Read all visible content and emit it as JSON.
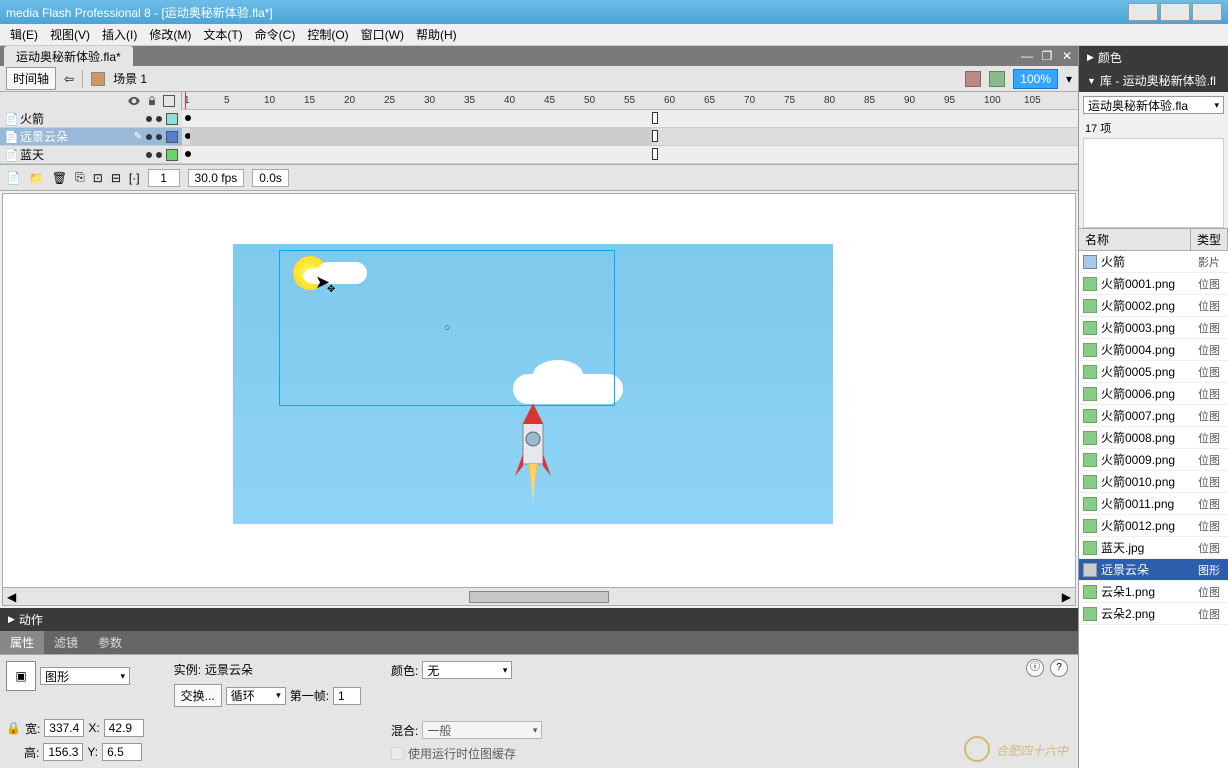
{
  "titlebar": {
    "title": "media Flash Professional 8 - [运动奥秘新体验.fla*]"
  },
  "menu": [
    "辑(E)",
    "视图(V)",
    "插入(I)",
    "修改(M)",
    "文本(T)",
    "命令(C)",
    "控制(O)",
    "窗口(W)",
    "帮助(H)"
  ],
  "doc": {
    "tab": "运动奥秘新体验.fla*",
    "timeline_btn": "时间轴",
    "scene": "场景 1",
    "zoom": "100%"
  },
  "ruler": [
    1,
    5,
    10,
    15,
    20,
    25,
    30,
    35,
    40,
    45,
    50,
    55,
    60,
    65,
    70,
    75,
    80,
    85,
    90,
    95,
    100,
    105
  ],
  "layers": [
    {
      "name": "火箭",
      "color": "#8de0d8"
    },
    {
      "name": "远景云朵",
      "color": "#5a7ecf"
    },
    {
      "name": "蓝天",
      "color": "#6ad46a"
    }
  ],
  "timeline_status": {
    "frame": "1",
    "fps": "30.0 fps",
    "time": "0.0s"
  },
  "panels": {
    "actions": "动作",
    "color": "颜色",
    "library": "库 - 运动奥秘新体验.fl",
    "lib_file": "运动奥秘新体验.fla",
    "lib_count": "17 项"
  },
  "lib_headers": {
    "name": "名称",
    "type": "类型"
  },
  "library": [
    {
      "name": "火箭",
      "type": "影片",
      "kind": "mc"
    },
    {
      "name": "火箭0001.png",
      "type": "位图",
      "kind": "bmp"
    },
    {
      "name": "火箭0002.png",
      "type": "位图",
      "kind": "bmp"
    },
    {
      "name": "火箭0003.png",
      "type": "位图",
      "kind": "bmp"
    },
    {
      "name": "火箭0004.png",
      "type": "位图",
      "kind": "bmp"
    },
    {
      "name": "火箭0005.png",
      "type": "位图",
      "kind": "bmp"
    },
    {
      "name": "火箭0006.png",
      "type": "位图",
      "kind": "bmp"
    },
    {
      "name": "火箭0007.png",
      "type": "位图",
      "kind": "bmp"
    },
    {
      "name": "火箭0008.png",
      "type": "位图",
      "kind": "bmp"
    },
    {
      "name": "火箭0009.png",
      "type": "位图",
      "kind": "bmp"
    },
    {
      "name": "火箭0010.png",
      "type": "位图",
      "kind": "bmp"
    },
    {
      "name": "火箭0011.png",
      "type": "位图",
      "kind": "bmp"
    },
    {
      "name": "火箭0012.png",
      "type": "位图",
      "kind": "bmp"
    },
    {
      "name": "蓝天.jpg",
      "type": "位图",
      "kind": "bmp"
    },
    {
      "name": "远景云朵",
      "type": "图形",
      "kind": "gr",
      "sel": true
    },
    {
      "name": "云朵1.png",
      "type": "位图",
      "kind": "bmp"
    },
    {
      "name": "云朵2.png",
      "type": "位图",
      "kind": "bmp"
    }
  ],
  "prop_tabs": [
    "属性",
    "滤镜",
    "参数"
  ],
  "props": {
    "type": "图形",
    "instance_lbl": "实例:",
    "instance": "远景云朵",
    "swap": "交换...",
    "loop": "循环",
    "firstframe_lbl": "第一帧:",
    "firstframe": "1",
    "color_lbl": "颜色:",
    "color": "无",
    "blend_lbl": "混合:",
    "blend": "一般",
    "cache": "使用运行时位图缓存",
    "w_lbl": "宽:",
    "w": "337.4",
    "x_lbl": "X:",
    "x": "42.9",
    "h_lbl": "高:",
    "h": "156.3",
    "y_lbl": "Y:",
    "y": "6.5"
  },
  "watermark": "合肥四十六中"
}
